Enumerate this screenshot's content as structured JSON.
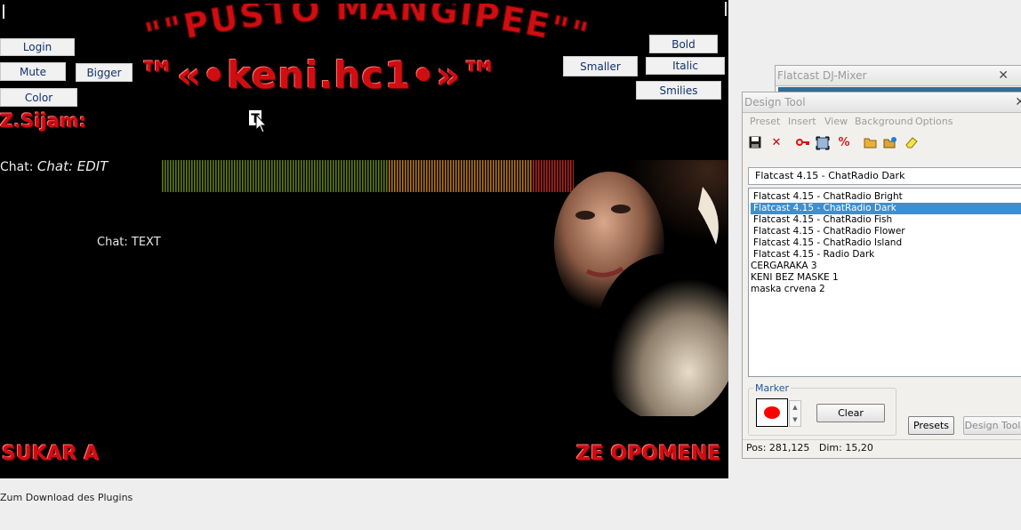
{
  "stage": {
    "title_arc": "\"\"PUSTO MANGIPEE\"\"",
    "subtitle": "™«•keni.hc1•»™",
    "heading_left": "Z.Sijam:",
    "chat_edit_label": "Chat:",
    "chat_edit_value": "Chat: EDIT",
    "chat_text_label": "Chat: TEXT",
    "marquee_left": "SUKAR A",
    "marquee_right": "ZE OPOMENE",
    "buttons": {
      "login": "Login",
      "mute": "Mute",
      "bigger": "Bigger",
      "color": "Color",
      "smaller": "Smaller",
      "bold": "Bold",
      "italic": "Italic",
      "smilies": "Smilies"
    },
    "cursor_glyph": "T",
    "meter_colors": [
      "#5f7a10",
      "#b0741a",
      "#b0251c"
    ]
  },
  "download_link": "Zum Download des Plugins",
  "djmixer": {
    "title": "Flatcast DJ-Mixer",
    "close": "✕"
  },
  "design_tool": {
    "title": "Design Tool",
    "close": "✕",
    "menu": [
      "Preset",
      "Insert",
      "View",
      "Background",
      "Options"
    ],
    "toolbar_icons": [
      "save-icon",
      "delete-icon",
      "key-icon",
      "fit-icon",
      "percent-icon",
      "open-folder-icon",
      "refresh-icon",
      "eraser-icon"
    ],
    "selected_preset": "Flatcast 4.15 - ChatRadio Dark",
    "presets": [
      "Flatcast 4.15 - ChatRadio Bright",
      "Flatcast 4.15 - ChatRadio Dark",
      "Flatcast 4.15 - ChatRadio Fish",
      "Flatcast 4.15 - ChatRadio Flower",
      "Flatcast 4.15 - ChatRadio Island",
      "Flatcast 4.15 - Radio Dark",
      "CERGARAKA 3",
      "KENI BEZ MASKE 1",
      "maska crvena 2"
    ],
    "marker_label": "Marker",
    "marker_color": "#ff0000",
    "clear_label": "Clear",
    "presets_button": "Presets",
    "design_tool_button": "Design Tool",
    "status_pos": "Pos: 281,125",
    "status_dim": "Dim: 15,20"
  }
}
